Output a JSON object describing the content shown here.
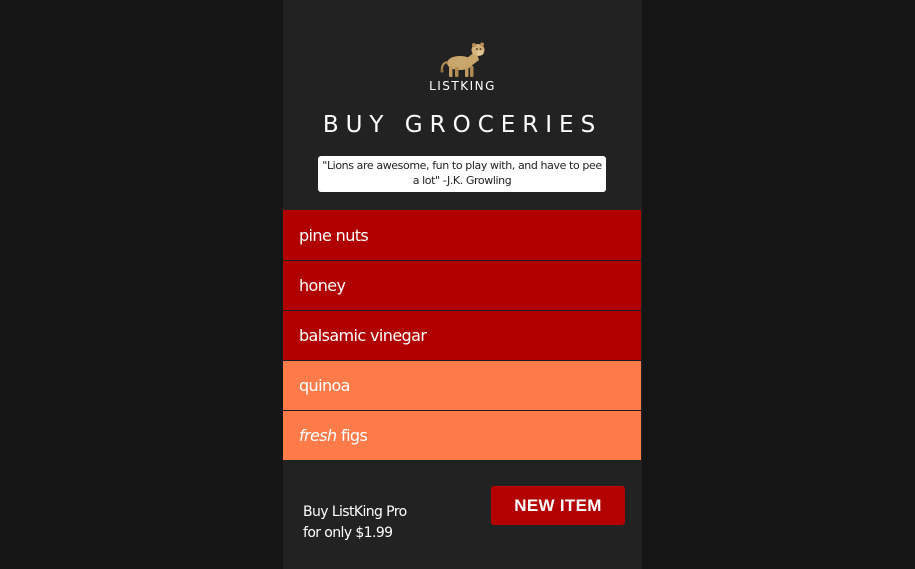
{
  "logo": {
    "brand": "LISTKING",
    "icon": "lion-icon"
  },
  "list_title": "BUY GROCERIES",
  "quote": "\"Lions are awesome, fun to play with, and have to pee a lot\" -J.K. Growling",
  "items": [
    {
      "text": "pine nuts",
      "color": "#b00000"
    },
    {
      "text": "honey",
      "color": "#b00000"
    },
    {
      "text": "balsamic vinegar",
      "color": "#b00000"
    },
    {
      "text": "quinoa",
      "color": "#ff7c4a"
    },
    {
      "emphasis": "fresh",
      "text": " figs",
      "color": "#ff7c4a"
    }
  ],
  "promo": {
    "line1": "Buy ListKing Pro",
    "line2": "for only $1.99"
  },
  "new_item_label": "NEW ITEM",
  "colors": {
    "background": "#151515",
    "panel": "#222222",
    "accent_red": "#b00000",
    "accent_orange": "#ff7c4a"
  }
}
